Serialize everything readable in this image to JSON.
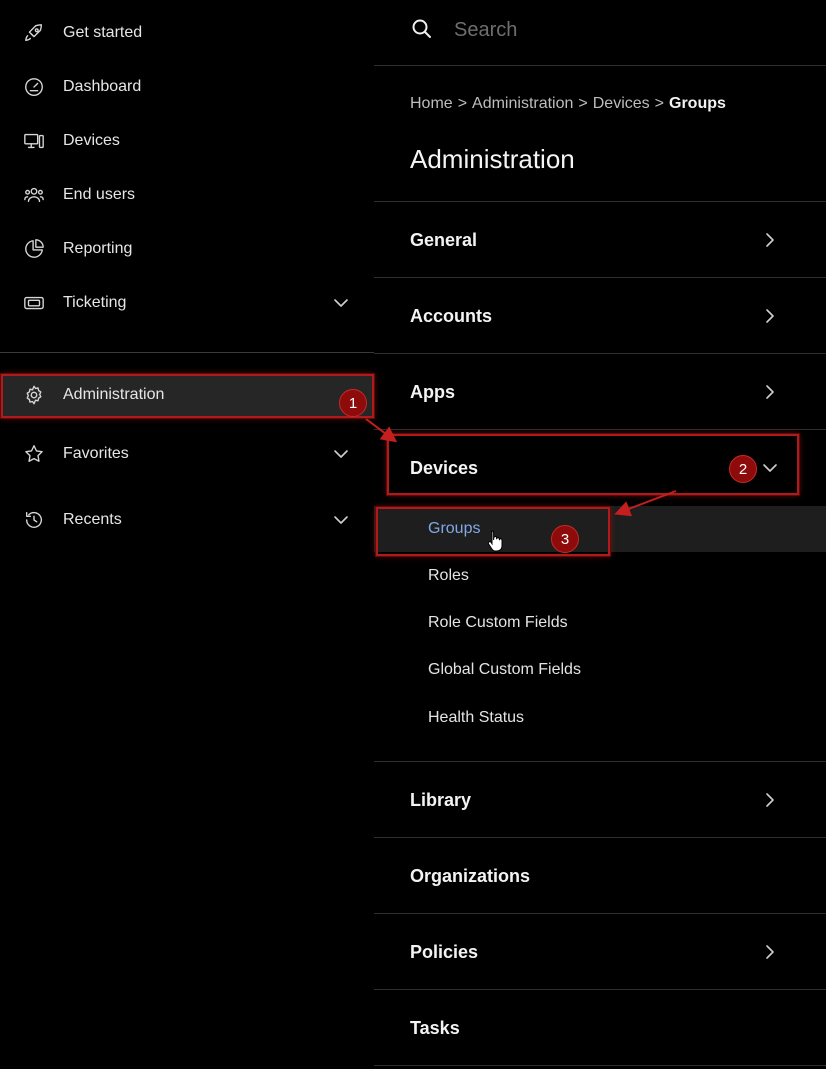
{
  "nav": {
    "items": [
      {
        "label": "Get started",
        "icon": "rocket-icon"
      },
      {
        "label": "Dashboard",
        "icon": "gauge-icon"
      },
      {
        "label": "Devices",
        "icon": "devices-icon"
      },
      {
        "label": "End users",
        "icon": "users-icon"
      },
      {
        "label": "Reporting",
        "icon": "pie-chart-icon"
      },
      {
        "label": "Ticketing",
        "icon": "ticket-icon"
      }
    ],
    "secondary": [
      {
        "label": "Administration",
        "icon": "gear-icon"
      },
      {
        "label": "Favorites",
        "icon": "star-icon"
      },
      {
        "label": "Recents",
        "icon": "history-icon"
      }
    ]
  },
  "search": {
    "placeholder": "Search"
  },
  "breadcrumb": {
    "home": "Home",
    "administration": "Administration",
    "devices": "Devices",
    "current": "Groups"
  },
  "page": {
    "title": "Administration"
  },
  "sections": {
    "general": "General",
    "accounts": "Accounts",
    "apps": "Apps",
    "devices": "Devices",
    "library": "Library",
    "organizations": "Organizations",
    "policies": "Policies",
    "tasks": "Tasks"
  },
  "device_subitems": {
    "groups": "Groups",
    "roles": "Roles",
    "role_custom_fields": "Role Custom Fields",
    "global_custom_fields": "Global Custom Fields",
    "health_status": "Health Status"
  },
  "annotations": {
    "step1": "1",
    "step2": "2",
    "step3": "3"
  },
  "colors": {
    "annotation": "#b01a1a",
    "selected_text": "#7fa8e6"
  }
}
